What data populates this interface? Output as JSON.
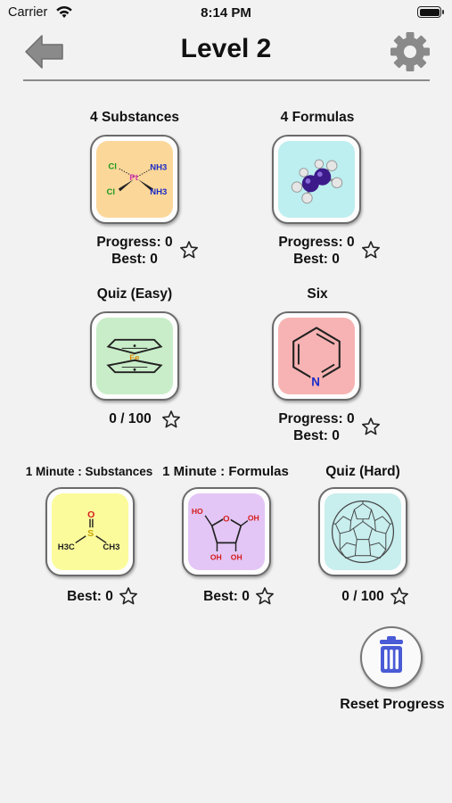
{
  "status_bar": {
    "carrier": "Carrier",
    "time": "8:14 PM"
  },
  "nav": {
    "title": "Level 2"
  },
  "tiles": [
    {
      "label": "4 Substances",
      "progress": "Progress: 0",
      "best": "Best: 0",
      "bg": "#fbd79a",
      "art_text": {
        "cl1": "Cl",
        "pt": "Pt",
        "nh3_1": "NH3",
        "cl2": "Cl",
        "nh3_2": "NH3"
      }
    },
    {
      "label": "4 Formulas",
      "progress": "Progress: 0",
      "best": "Best: 0",
      "bg": "#bdeef0"
    },
    {
      "label": "Quiz (Easy)",
      "score": "0 / 100",
      "bg": "#c8edc8",
      "art_text": {
        "fe": "Fe"
      }
    },
    {
      "label": "Six",
      "progress": "Progress: 0",
      "best": "Best: 0",
      "bg": "#f7b3b3",
      "art_text": {
        "n": "N"
      }
    },
    {
      "label": "1 Minute : Substances",
      "best": "Best: 0",
      "bg": "#fbfb9c",
      "art_text": {
        "o": "O",
        "s": "S",
        "ch3_l": "H3C",
        "ch3_r": "CH3"
      }
    },
    {
      "label": "1 Minute : Formulas",
      "best": "Best: 0",
      "bg": "#e3c6f5",
      "art_text": {
        "ho": "HO",
        "oh1": "OH",
        "oh2": "OH",
        "oh3": "OH",
        "o": "O"
      }
    },
    {
      "label": "Quiz (Hard)",
      "score": "0 / 100",
      "bg": "#c8eeee"
    }
  ],
  "reset": {
    "label": "Reset Progress"
  },
  "colors": {
    "arrow": "#8a8a8a",
    "gear": "#8a8a8a",
    "trash": "#4a5bd6"
  }
}
